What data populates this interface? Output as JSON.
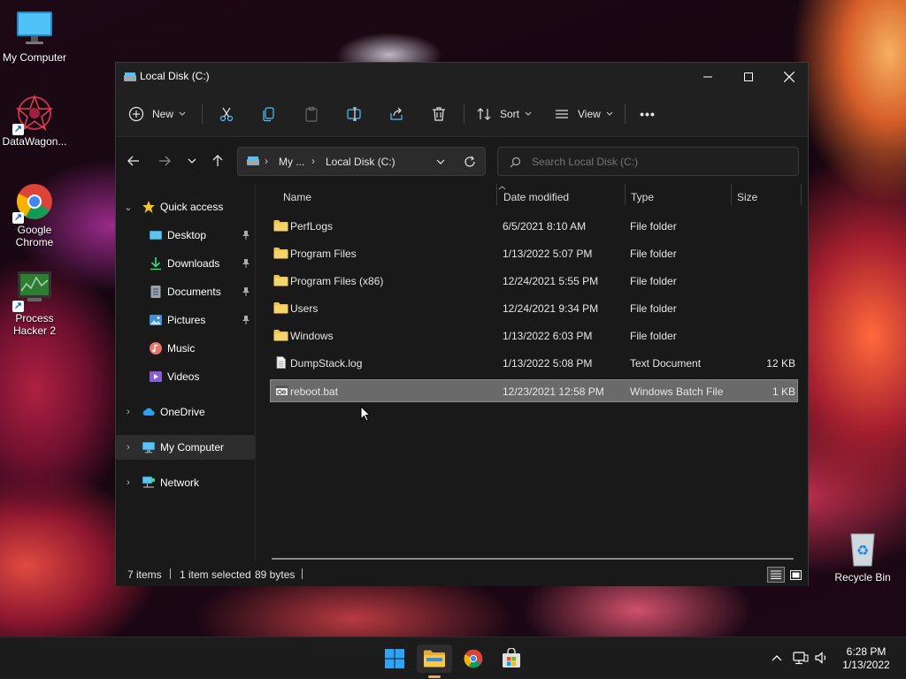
{
  "desktop": {
    "icons": [
      {
        "label": "My Computer",
        "icon": "monitor-icon"
      },
      {
        "label": "DataWagon...",
        "icon": "datawagon-icon"
      },
      {
        "label": "Google Chrome",
        "icon": "chrome-icon"
      },
      {
        "label": "Process Hacker 2",
        "icon": "process-hacker-icon"
      },
      {
        "label": "Recycle Bin",
        "icon": "recycle-bin-icon"
      }
    ]
  },
  "window": {
    "title": "Local Disk (C:)",
    "toolbar": {
      "new_label": "New",
      "sort_label": "Sort",
      "view_label": "View",
      "more_label": "•••"
    },
    "address": {
      "crumb_parent": "My ...",
      "crumb_current": "Local Disk (C:)"
    },
    "search": {
      "placeholder": "Search Local Disk (C:)"
    },
    "sidebar": {
      "quick_access": "Quick access",
      "items": [
        {
          "label": "Desktop",
          "icon": "desktop-folder-icon",
          "pinned": true
        },
        {
          "label": "Downloads",
          "icon": "downloads-icon",
          "pinned": true
        },
        {
          "label": "Documents",
          "icon": "documents-icon",
          "pinned": true
        },
        {
          "label": "Pictures",
          "icon": "pictures-icon",
          "pinned": true
        },
        {
          "label": "Music",
          "icon": "music-icon",
          "pinned": false
        },
        {
          "label": "Videos",
          "icon": "videos-icon",
          "pinned": false
        }
      ],
      "onedrive": "OneDrive",
      "my_computer": "My Computer",
      "network": "Network"
    },
    "columns": {
      "name": "Name",
      "date": "Date modified",
      "type": "Type",
      "size": "Size"
    },
    "files": [
      {
        "name": "PerfLogs",
        "date": "6/5/2021 8:10 AM",
        "type": "File folder",
        "size": "",
        "icon": "folder-icon"
      },
      {
        "name": "Program Files",
        "date": "1/13/2022 5:07 PM",
        "type": "File folder",
        "size": "",
        "icon": "folder-icon"
      },
      {
        "name": "Program Files (x86)",
        "date": "12/24/2021 5:55 PM",
        "type": "File folder",
        "size": "",
        "icon": "folder-icon"
      },
      {
        "name": "Users",
        "date": "12/24/2021 9:34 PM",
        "type": "File folder",
        "size": "",
        "icon": "folder-icon"
      },
      {
        "name": "Windows",
        "date": "1/13/2022 6:03 PM",
        "type": "File folder",
        "size": "",
        "icon": "folder-icon"
      },
      {
        "name": "DumpStack.log",
        "date": "1/13/2022 5:08 PM",
        "type": "Text Document",
        "size": "12 KB",
        "icon": "text-file-icon"
      },
      {
        "name": "reboot.bat",
        "date": "12/23/2021 12:58 PM",
        "type": "Windows Batch File",
        "size": "1 KB",
        "icon": "batch-file-icon",
        "selected": true
      }
    ],
    "status": {
      "item_count": "7 items",
      "selection": "1 item selected",
      "selection_size": "89 bytes"
    }
  },
  "taskbar": {
    "clock_time": "6:28 PM",
    "clock_date": "1/13/2022"
  },
  "colors": {
    "folder": "#f0c24a",
    "accent": "#4cc2ff",
    "selection": "#6a6a6a"
  }
}
